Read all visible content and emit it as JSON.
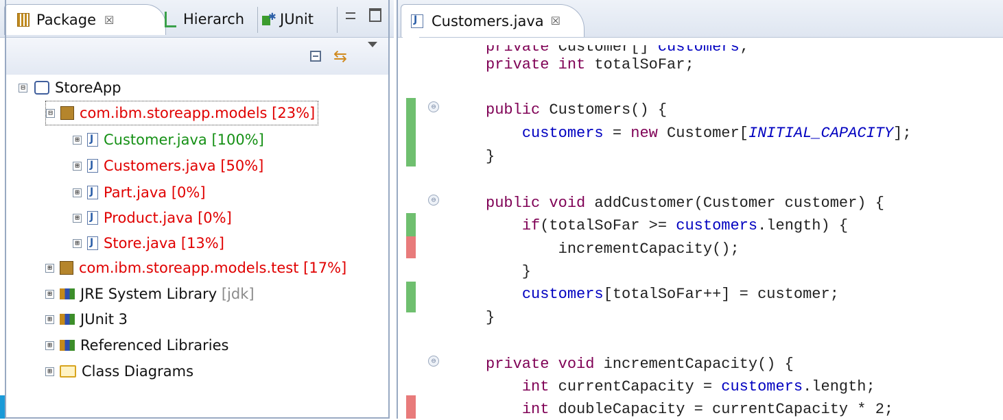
{
  "left_panel": {
    "tabs": [
      {
        "label": "Package",
        "close": "☒"
      },
      {
        "label": "Hierarch"
      },
      {
        "label": "JUnit"
      }
    ],
    "tree": [
      {
        "label": "StoreApp",
        "suffix": "",
        "color": "#111111",
        "icon": "project-icon",
        "expand": "⊟"
      },
      {
        "label": "com.ibm.storeapp.models",
        "suffix": "[23%]",
        "color": "#e00000",
        "icon": "package-icon",
        "expand": "⊟"
      },
      {
        "label": "Customer.java",
        "suffix": "[100%]",
        "color": "#159015",
        "icon": "java-file-icon",
        "expand": "⊞"
      },
      {
        "label": "Customers.java",
        "suffix": "[50%]",
        "color": "#e00000",
        "icon": "java-file-icon",
        "expand": "⊞"
      },
      {
        "label": "Part.java",
        "suffix": "[0%]",
        "color": "#e00000",
        "icon": "java-file-icon",
        "expand": "⊞"
      },
      {
        "label": "Product.java",
        "suffix": "[0%]",
        "color": "#e00000",
        "icon": "java-file-icon",
        "expand": "⊞"
      },
      {
        "label": "Store.java",
        "suffix": "[13%]",
        "color": "#e00000",
        "icon": "java-file-icon",
        "expand": "⊞"
      },
      {
        "label": "com.ibm.storeapp.models.test",
        "suffix": "[17%]",
        "color": "#e00000",
        "icon": "package-icon",
        "expand": "⊞"
      },
      {
        "label": "JRE System Library",
        "suffix": "[jdk]",
        "color": "#111111",
        "icon": "library-icon",
        "expand": "⊞"
      },
      {
        "label": "JUnit 3",
        "suffix": "",
        "color": "#111111",
        "icon": "library-icon",
        "expand": "⊞"
      },
      {
        "label": "Referenced Libraries",
        "suffix": "",
        "color": "#111111",
        "icon": "library-icon",
        "expand": "⊞"
      },
      {
        "label": "Class Diagrams",
        "suffix": "",
        "color": "#111111",
        "icon": "folder-icon",
        "expand": "⊞"
      }
    ]
  },
  "editor": {
    "tab": {
      "label": "Customers.java",
      "close": "☒"
    },
    "code_lines": [
      "    private Customer[] customers;",
      "    private int totalSoFar;",
      "",
      "    public Customers() {",
      "        customers = new Customer[INITIAL_CAPACITY];",
      "    }",
      "",
      "    public void addCustomer(Customer customer) {",
      "        if(totalSoFar >= customers.length) {",
      "            incrementCapacity();",
      "        }",
      "        customers[totalSoFar++] = customer;",
      "    }",
      "",
      "    private void incrementCapacity() {",
      "        int currentCapacity = customers.length;",
      "        int doubleCapacity = currentCapacity * 2;"
    ]
  },
  "colors": {
    "covered": "#6fbf6f",
    "uncovered": "#e87b7b",
    "keyword": "#7f0055",
    "field": "#0000c0"
  }
}
